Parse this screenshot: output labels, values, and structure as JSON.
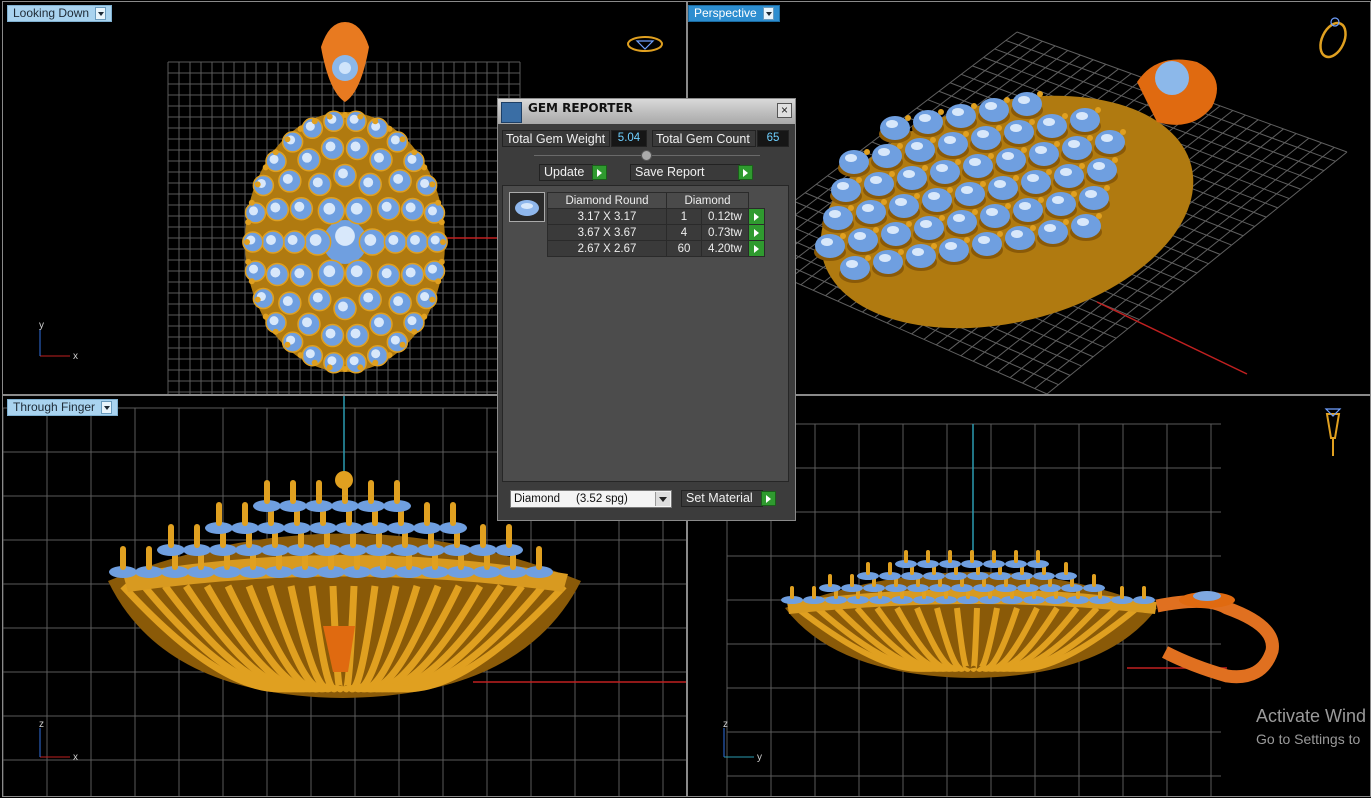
{
  "viewports": {
    "top_left": {
      "label": "Looking Down"
    },
    "top_right": {
      "label": "Perspective"
    },
    "bottom_left": {
      "label": "Through Finger"
    },
    "bottom_right": {
      "label": ""
    }
  },
  "axes": {
    "top_left": {
      "v": "y",
      "h": "x"
    },
    "bottom_left": {
      "v": "z",
      "h": "x"
    },
    "bottom_right": {
      "v": "z",
      "h": "y"
    }
  },
  "dialog": {
    "title": "GEM REPORTER",
    "close_label": "×",
    "total_weight_label": "Total Gem Weight",
    "total_weight_value": "5.04",
    "total_count_label": "Total Gem Count",
    "total_count_value": "65",
    "update_label": "Update",
    "save_report_label": "Save Report",
    "table": {
      "col_shape": "Diamond Round",
      "col_material": "Diamond",
      "rows": [
        {
          "size": "3.17 X 3.17",
          "count": "1",
          "weight": "0.12tw"
        },
        {
          "size": "3.67 X 3.67",
          "count": "4",
          "weight": "0.73tw"
        },
        {
          "size": "2.67 X 2.67",
          "count": "60",
          "weight": "4.20tw"
        }
      ]
    },
    "material_select": "Diamond     (3.52 spg)",
    "set_material_label": "Set Material"
  },
  "watermark": {
    "line1": "Activate Wind",
    "line2": "Go to Settings to"
  },
  "colors": {
    "gold": "#e0a020",
    "gem": "#6f9fe0",
    "grid": "#6a6a6a",
    "label_bg": "#a9d3ef"
  },
  "icons": [
    "ring-top-view-icon",
    "ring-perspective-icon",
    "ring-side-view-icon",
    "gem-thumbnail-icon"
  ]
}
